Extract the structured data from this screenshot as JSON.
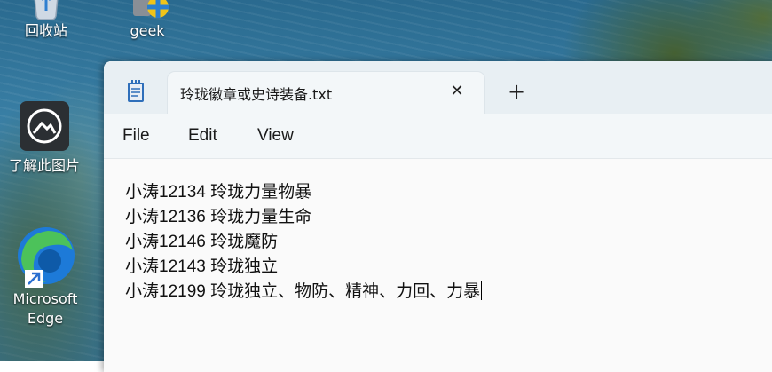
{
  "desktop": {
    "icons": [
      {
        "label": "回收站",
        "icon": "recycle-bin-icon"
      },
      {
        "label": "geek",
        "icon": "geek-app-icon"
      },
      {
        "label": "了解此图片",
        "icon": "camera-icon"
      },
      {
        "label": "Microsoft\nEdge",
        "line1": "Microsoft",
        "line2": "Edge",
        "icon": "edge-icon"
      }
    ]
  },
  "window": {
    "app_icon": "notepad-icon",
    "tab_title": "玲珑徽章或史诗装备.txt",
    "close_icon": "close-icon",
    "close_glyph": "✕",
    "new_tab_icon": "plus-icon",
    "new_tab_glyph": "+",
    "menu": {
      "file": "File",
      "edit": "Edit",
      "view": "View"
    },
    "lines": [
      "小涛12134 玲珑力量物暴",
      "小涛12136 玲珑力量生命",
      "小涛12146 玲珑魔防",
      "小涛12143 玲珑独立",
      "小涛12199 玲珑独立、物防、精神、力回、力暴"
    ]
  },
  "colors": {
    "titlebar": "#e8eff3",
    "menubar": "#f3f7f9",
    "editor": "#fafafa",
    "edge_blue": "#1d7ad8",
    "edge_green": "#4cc25a"
  }
}
